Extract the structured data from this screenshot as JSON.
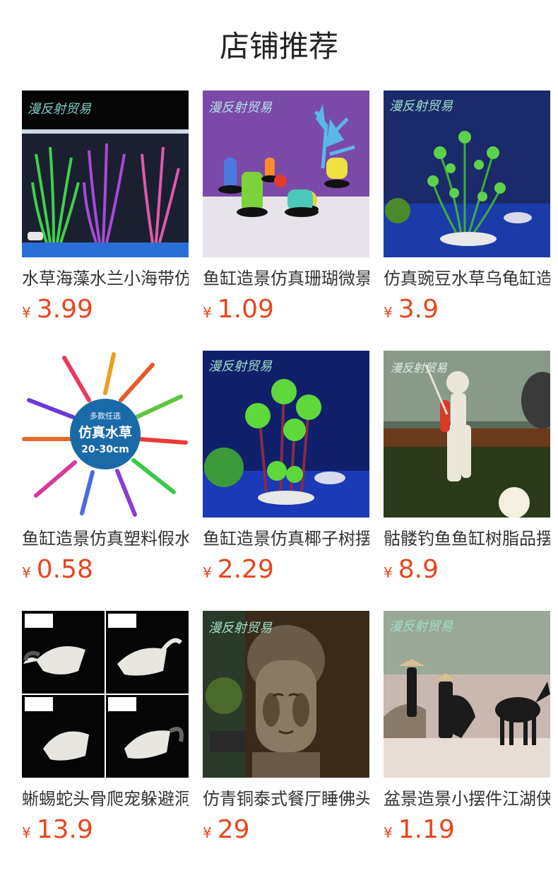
{
  "header": {
    "title": "店铺推荐"
  },
  "colors": {
    "price": "#e9461c",
    "text": "#333333"
  },
  "products": [
    {
      "name": "水草海藻水兰小海带仿",
      "currency": "¥",
      "price": "3.99",
      "watermark": "漫反射贸易"
    },
    {
      "name": "鱼缸造景仿真珊瑚微景",
      "currency": "¥",
      "price": "1.09",
      "watermark": "漫反射贸易"
    },
    {
      "name": "仿真豌豆水草乌龟缸造",
      "currency": "¥",
      "price": "3.9",
      "watermark": "漫反射贸易"
    },
    {
      "name": "鱼缸造景仿真塑料假水",
      "currency": "¥",
      "price": "0.58",
      "badge": [
        "多款任选",
        "仿真水草",
        "20-30cm"
      ]
    },
    {
      "name": "鱼缸造景仿真椰子树摆",
      "currency": "¥",
      "price": "2.29",
      "watermark": "漫反射贸易"
    },
    {
      "name": "骷髅钓鱼鱼缸树脂品摆",
      "currency": "¥",
      "price": "8.9",
      "watermark": "漫反射贸易"
    },
    {
      "name": "蜥蜴蛇头骨爬宠躲避洞",
      "currency": "¥",
      "price": "13.9"
    },
    {
      "name": "仿青铜泰式餐厅睡佛头",
      "currency": "¥",
      "price": "29",
      "watermark": "漫反射贸易"
    },
    {
      "name": "盆景造景小摆件江湖侠",
      "currency": "¥",
      "price": "1.19",
      "watermark": "漫反射贸易"
    }
  ]
}
